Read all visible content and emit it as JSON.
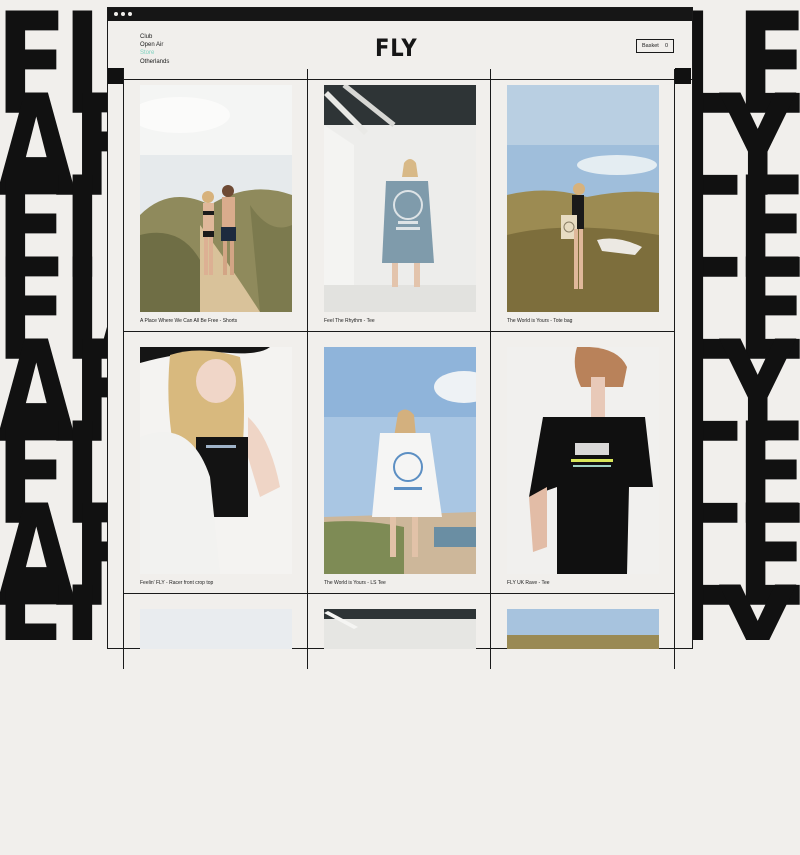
{
  "background": {
    "left_rows": [
      "FI",
      "AFI",
      "FI",
      "FIAF",
      "AFI",
      "FI",
      "AFI",
      "FI"
    ],
    "right_rows": [
      "LE",
      "LY",
      "LE",
      "LEY",
      "LY",
      "LE",
      "LEY",
      "LY"
    ]
  },
  "header": {
    "logo": "FLY",
    "nav": [
      "Club",
      "Open Air",
      "Store",
      "Otherlands"
    ],
    "active_nav": "Store",
    "basket_label": "Basket",
    "basket_count": "0"
  },
  "products": [
    {
      "title": "A Place Where We Can All Be Free - Shorts"
    },
    {
      "title": "Feel The Rhythm - Tee"
    },
    {
      "title": "The World is Yours - Tote bag"
    },
    {
      "title": "Feelin' FLY - Racer front crop top"
    },
    {
      "title": "The World is Yours - LS Tee"
    },
    {
      "title": "FLY UK Rave - Tee"
    }
  ],
  "colors": {
    "accent": "#7fd2bf",
    "ink": "#161616",
    "paper": "#f1efec"
  }
}
